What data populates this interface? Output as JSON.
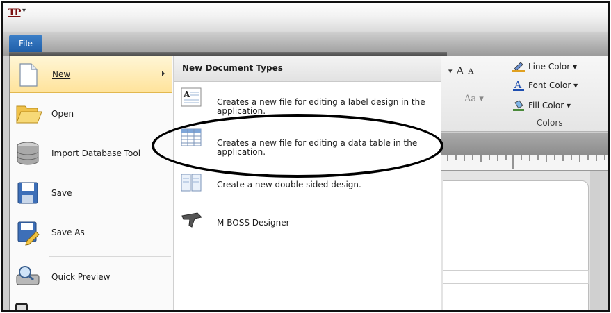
{
  "app": {
    "logo_text": "TP",
    "quick_access_glyph": "▾"
  },
  "file_tab": {
    "label": "File"
  },
  "menu": {
    "items": [
      {
        "label": "New",
        "icon": "new-document-icon",
        "selected": true,
        "has_submenu": true
      },
      {
        "label": "Open",
        "icon": "open-folder-icon"
      },
      {
        "label": "Import Database Tool",
        "icon": "database-icon"
      },
      {
        "label": "Save",
        "icon": "save-icon"
      },
      {
        "label": "Save As",
        "icon": "save-as-icon"
      },
      {
        "label": "Quick Preview",
        "icon": "quick-preview-icon"
      }
    ]
  },
  "submenu": {
    "header": "New Document Types",
    "items": [
      {
        "text": "Creates a new file for editing a label design in the application.",
        "icon": "label-design-icon"
      },
      {
        "text": "Creates a new file for editing a data table in the application.",
        "icon": "data-table-icon"
      },
      {
        "text": "Create a new double sided design.",
        "icon": "double-sided-icon"
      },
      {
        "text": "M-BOSS Designer",
        "icon": "mboss-designer-icon"
      }
    ]
  },
  "ribbon": {
    "grow_font": "A",
    "shrink_font": "A",
    "change_case": "Aa ▾",
    "line_color": "Line Color ▾",
    "font_color": "Font Color ▾",
    "fill_color": "Fill Color ▾",
    "group_label": "Colors"
  },
  "ruler": {
    "mark": "3"
  },
  "colors": {
    "file_tab": "#2a6cb8",
    "selection": "#ffe39b",
    "annotation": "#000000"
  }
}
